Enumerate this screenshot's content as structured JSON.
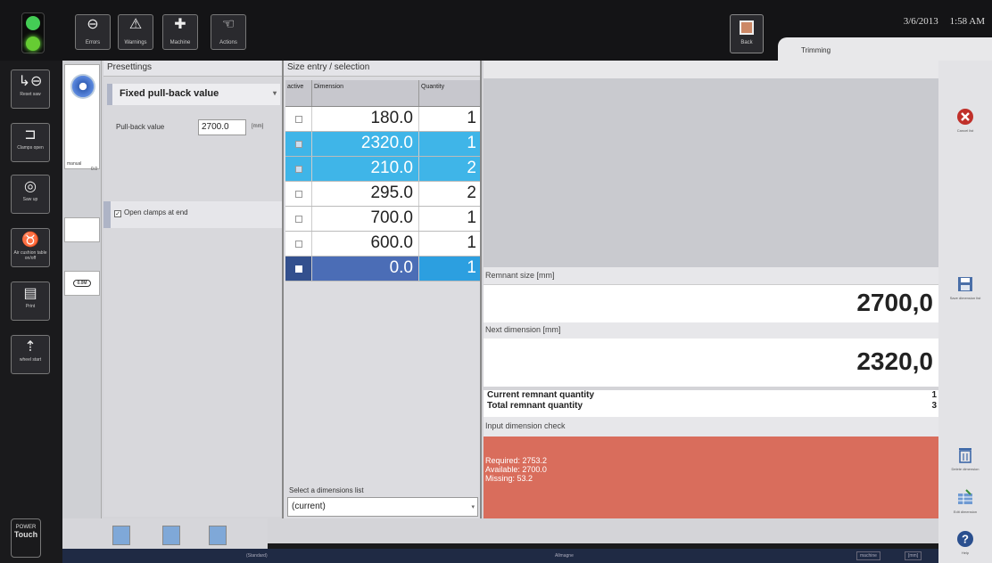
{
  "topbar": {
    "buttons": [
      {
        "icon": "minus-circle-icon",
        "label": "Errors"
      },
      {
        "icon": "warning-icon",
        "label": "Warnings"
      },
      {
        "icon": "wrench-icon",
        "label": "Machine"
      },
      {
        "icon": "hand-icon",
        "label": "Actions"
      }
    ],
    "back_label": "Back",
    "date": "3/6/2013",
    "time": "1:58 AM",
    "tab": "Trimming"
  },
  "sidebar": {
    "items": [
      {
        "icon": "reset-icon",
        "label": "Reset saw"
      },
      {
        "icon": "clamp-icon",
        "label": "Clamps open"
      },
      {
        "icon": "saw-icon",
        "label": "Saw up"
      },
      {
        "icon": "air-cushion-icon",
        "label": "Air cushion table on/off"
      },
      {
        "icon": "print-icon",
        "label": "Print"
      },
      {
        "icon": "start-icon",
        "label": "wheel start"
      }
    ],
    "brand_top": "POWER",
    "brand": "Touch"
  },
  "narrow": {
    "card1_label": "manual",
    "card1_sub": "0.0",
    "badge": "0.0M"
  },
  "presettings": {
    "title": "Presettings",
    "mode": "Fixed pull-back value",
    "pullback_label": "Pull-back value",
    "pullback_value": "2700.0",
    "pullback_unit": "[mm]",
    "clamps_label": "Open clamps at end"
  },
  "size_entry": {
    "title": "Size entry / selection",
    "columns": [
      "active",
      "Dimension",
      "Quantity"
    ],
    "rows": [
      {
        "dimension": "180.0",
        "quantity": "1",
        "state": "normal"
      },
      {
        "dimension": "2320.0",
        "quantity": "1",
        "state": "sel"
      },
      {
        "dimension": "210.0",
        "quantity": "2",
        "state": "sel"
      },
      {
        "dimension": "295.0",
        "quantity": "2",
        "state": "normal"
      },
      {
        "dimension": "700.0",
        "quantity": "1",
        "state": "normal"
      },
      {
        "dimension": "600.0",
        "quantity": "1",
        "state": "normal"
      },
      {
        "dimension": "0.0",
        "quantity": "1",
        "state": "edit"
      }
    ],
    "list_label": "Select a dimensions list",
    "list_value": "(current)"
  },
  "info": {
    "remnant_label": "Remnant size [mm]",
    "remnant_value": "2700,0",
    "next_label": "Next dimension [mm]",
    "next_value": "2320,0",
    "current_qty_label": "Current remnant quantity",
    "current_qty_value": "1",
    "total_qty_label": "Total remnant quantity",
    "total_qty_value": "3",
    "check_label": "Input dimension check",
    "required": "Required: 2753.2",
    "available": "Available: 2700.0",
    "missing": "Missing: 53.2",
    "alert_color": "#d96d5c"
  },
  "rsidebar": {
    "cancel": "Cancel list",
    "save": "Save dimension list",
    "delete": "Delete dimension",
    "edit": "Edit dimension",
    "help": "Help"
  },
  "statusbar": {
    "left": "(Standard)",
    "middle": "Allmagne",
    "right1": "machine",
    "right2": "[mm]"
  }
}
